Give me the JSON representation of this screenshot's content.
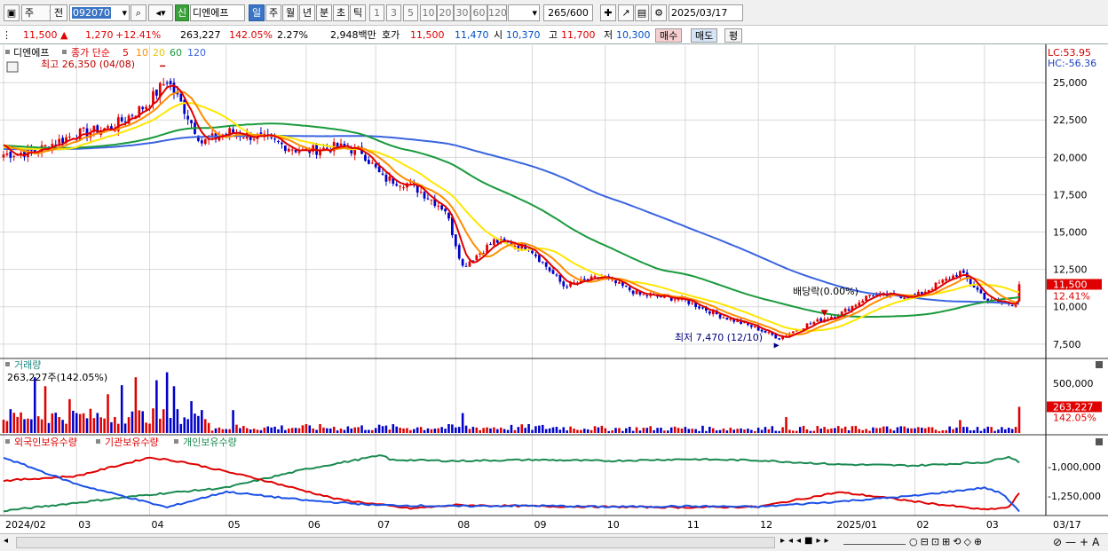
{
  "toolbar": {
    "market": "주",
    "mode": "전",
    "code": "092070",
    "badge": "신",
    "name": "디엔에프",
    "periods": [
      "일",
      "주",
      "월",
      "년",
      "분",
      "초",
      "틱"
    ],
    "selected_period": "일",
    "minutes": [
      "1",
      "3",
      "5",
      "10",
      "20",
      "30",
      "60",
      "120"
    ],
    "count": "265",
    "count_total": "/600",
    "date": "2025/03/17"
  },
  "quote": {
    "price": "11,500",
    "change": "1,270",
    "change_pct": "+12.41%",
    "volume": "263,227",
    "volume_ratio": "142.05%",
    "turnover": "2.27%",
    "amount": "2,948백만",
    "hoga_label": "호가",
    "ask": "11,500",
    "bid": "11,470",
    "open_label": "시",
    "open": "10,370",
    "high_label": "고",
    "high": "11,700",
    "low_label": "저",
    "low": "10,300",
    "buy_label": "매수",
    "sell_label": "매도",
    "eval_label": "평"
  },
  "colors": {
    "candle_up": "#e00000",
    "candle_down": "#0000c8",
    "ma5": "#e00000",
    "ma10": "#ff8c00",
    "ma20": "#ffe600",
    "ma60": "#1a9a3c",
    "ma120": "#3a64e0",
    "foreign": "#1a50e6",
    "institution": "#e00000",
    "individual": "#1a8a50"
  },
  "chart_data": [
    {
      "type": "candlestick",
      "legend_prefix": "디엔에프",
      "legend_label": "종가 단순",
      "ma_periods": [
        "5",
        "10",
        "20",
        "60",
        "120"
      ],
      "lc_label": "LC:53.95",
      "hc_label": "HC:-56.36",
      "ylim": [
        6600,
        27500
      ],
      "y_ticks": [
        "25,000",
        "22,500",
        "20,000",
        "17,500",
        "15,000",
        "12,500",
        "10,000",
        "7,500"
      ],
      "y_tick_values": [
        25000,
        22500,
        20000,
        17500,
        15000,
        12500,
        10000,
        7500
      ],
      "current_price_label": "11,500",
      "current_pct_label": "12.41%",
      "high_annotation": "최고 26,350 (04/08)",
      "low_annotation": "최저 7,470 (12/10)",
      "dividend_annotation": "배당락(0.00%)",
      "x_ticks": [
        "2024/02",
        "03",
        "04",
        "05",
        "06",
        "07",
        "08",
        "09",
        "10",
        "11",
        "12",
        "2025/01",
        "02",
        "03",
        "03/17"
      ],
      "close_anchors": [
        {
          "date": "2024-02-01",
          "v": 20200
        },
        {
          "date": "2024-02-14",
          "v": 20400
        },
        {
          "date": "2024-02-29",
          "v": 21500
        },
        {
          "date": "2024-03-15",
          "v": 22000
        },
        {
          "date": "2024-03-29",
          "v": 23500
        },
        {
          "date": "2024-04-08",
          "v": 25200
        },
        {
          "date": "2024-04-15",
          "v": 23200
        },
        {
          "date": "2024-04-22",
          "v": 21000
        },
        {
          "date": "2024-05-02",
          "v": 21700
        },
        {
          "date": "2024-05-15",
          "v": 21300
        },
        {
          "date": "2024-05-31",
          "v": 20400
        },
        {
          "date": "2024-06-14",
          "v": 20700
        },
        {
          "date": "2024-06-25",
          "v": 20400
        },
        {
          "date": "2024-07-03",
          "v": 18600
        },
        {
          "date": "2024-07-15",
          "v": 18200
        },
        {
          "date": "2024-07-29",
          "v": 16500
        },
        {
          "date": "2024-08-05",
          "v": 12700
        },
        {
          "date": "2024-08-16",
          "v": 14400
        },
        {
          "date": "2024-08-30",
          "v": 14000
        },
        {
          "date": "2024-09-13",
          "v": 11400
        },
        {
          "date": "2024-09-30",
          "v": 12000
        },
        {
          "date": "2024-10-15",
          "v": 10800
        },
        {
          "date": "2024-10-31",
          "v": 10500
        },
        {
          "date": "2024-11-15",
          "v": 9400
        },
        {
          "date": "2024-11-29",
          "v": 8600
        },
        {
          "date": "2024-12-10",
          "v": 7900
        },
        {
          "date": "2024-12-20",
          "v": 8800
        },
        {
          "date": "2025-01-03",
          "v": 9600
        },
        {
          "date": "2025-01-15",
          "v": 10800
        },
        {
          "date": "2025-02-03",
          "v": 10700
        },
        {
          "date": "2025-02-20",
          "v": 12300
        },
        {
          "date": "2025-03-04",
          "v": 10400
        },
        {
          "date": "2025-03-12",
          "v": 10200
        },
        {
          "date": "2025-03-14",
          "v": 10230
        },
        {
          "date": "2025-03-17",
          "v": 11500
        }
      ]
    },
    {
      "type": "bar",
      "title": "거래량",
      "info": "263,227주(142.05%)",
      "y_ticks": [
        "500,000"
      ],
      "y_tick_values": [
        500000
      ],
      "ylim": [
        0,
        740000
      ],
      "current_label": "263,227",
      "current_pct_label": "142.05%",
      "last_value": 263227,
      "spikes": [
        {
          "date": "2024-02-14",
          "v": 560000
        },
        {
          "date": "2024-02-19",
          "v": 470000
        },
        {
          "date": "2024-02-28",
          "v": 340000
        },
        {
          "date": "2024-03-14",
          "v": 390000
        },
        {
          "date": "2024-03-20",
          "v": 480000
        },
        {
          "date": "2024-03-26",
          "v": 560000
        },
        {
          "date": "2024-04-03",
          "v": 530000
        },
        {
          "date": "2024-04-08",
          "v": 610000
        },
        {
          "date": "2024-04-10",
          "v": 470000
        },
        {
          "date": "2024-04-17",
          "v": 320000
        },
        {
          "date": "2024-05-03",
          "v": 230000
        },
        {
          "date": "2024-08-05",
          "v": 200000
        },
        {
          "date": "2024-12-12",
          "v": 160000
        },
        {
          "date": "2025-02-20",
          "v": 130000
        },
        {
          "date": "2025-03-17",
          "v": 263227
        }
      ]
    },
    {
      "type": "line",
      "series": [
        {
          "name": "외국인보유수량",
          "color_key": "foreign"
        },
        {
          "name": "기관보유수량",
          "color_key": "institution"
        },
        {
          "name": "개인보유수량",
          "color_key": "individual"
        }
      ],
      "y_ticks": [
        "-1,000,000",
        "-1,250,000"
      ],
      "y_tick_values": [
        -1000000,
        -1250000
      ],
      "ylim": [
        -1420000,
        -740000
      ],
      "individual_anchors": [
        {
          "date": "2024-02-01",
          "v": -1380000
        },
        {
          "date": "2024-03-01",
          "v": -1310000
        },
        {
          "date": "2024-04-01",
          "v": -1240000
        },
        {
          "date": "2024-05-01",
          "v": -1180000
        },
        {
          "date": "2024-06-01",
          "v": -1020000
        },
        {
          "date": "2024-07-03",
          "v": -900000
        },
        {
          "date": "2024-07-05",
          "v": -940000
        },
        {
          "date": "2024-08-01",
          "v": -950000
        },
        {
          "date": "2024-09-02",
          "v": -940000
        },
        {
          "date": "2024-10-01",
          "v": -950000
        },
        {
          "date": "2024-11-01",
          "v": -935000
        },
        {
          "date": "2024-12-02",
          "v": -945000
        },
        {
          "date": "2025-01-02",
          "v": -980000
        },
        {
          "date": "2025-02-03",
          "v": -990000
        },
        {
          "date": "2025-03-04",
          "v": -960000
        },
        {
          "date": "2025-03-12",
          "v": -910000
        },
        {
          "date": "2025-03-17",
          "v": -960000
        }
      ],
      "foreign_anchors": [
        {
          "date": "2024-02-01",
          "v": -920000
        },
        {
          "date": "2024-03-01",
          "v": -1150000
        },
        {
          "date": "2024-03-20",
          "v": -1250000
        },
        {
          "date": "2024-04-08",
          "v": -1350000
        },
        {
          "date": "2024-05-01",
          "v": -1215000
        },
        {
          "date": "2024-06-01",
          "v": -1290000
        },
        {
          "date": "2024-07-01",
          "v": -1330000
        },
        {
          "date": "2024-08-01",
          "v": -1340000
        },
        {
          "date": "2024-09-02",
          "v": -1335000
        },
        {
          "date": "2024-10-01",
          "v": -1345000
        },
        {
          "date": "2024-11-01",
          "v": -1340000
        },
        {
          "date": "2024-12-02",
          "v": -1345000
        },
        {
          "date": "2025-01-02",
          "v": -1300000
        },
        {
          "date": "2025-02-03",
          "v": -1250000
        },
        {
          "date": "2025-03-03",
          "v": -1180000
        },
        {
          "date": "2025-03-10",
          "v": -1230000
        },
        {
          "date": "2025-03-17",
          "v": -1380000
        }
      ],
      "institution_anchors": [
        {
          "date": "2024-02-01",
          "v": -1120000
        },
        {
          "date": "2024-03-01",
          "v": -1080000
        },
        {
          "date": "2024-04-01",
          "v": -920000
        },
        {
          "date": "2024-04-15",
          "v": -960000
        },
        {
          "date": "2024-05-15",
          "v": -1110000
        },
        {
          "date": "2024-06-14",
          "v": -1280000
        },
        {
          "date": "2024-07-03",
          "v": -1330000
        },
        {
          "date": "2024-07-15",
          "v": -1360000
        },
        {
          "date": "2024-08-01",
          "v": -1330000
        },
        {
          "date": "2024-09-02",
          "v": -1340000
        },
        {
          "date": "2024-10-01",
          "v": -1345000
        },
        {
          "date": "2024-11-01",
          "v": -1350000
        },
        {
          "date": "2024-12-02",
          "v": -1345000
        },
        {
          "date": "2025-01-02",
          "v": -1220000
        },
        {
          "date": "2025-01-20",
          "v": -1260000
        },
        {
          "date": "2025-02-03",
          "v": -1300000
        },
        {
          "date": "2025-03-03",
          "v": -1370000
        },
        {
          "date": "2025-03-12",
          "v": -1350000
        },
        {
          "date": "2025-03-17",
          "v": -1230000
        }
      ]
    }
  ]
}
